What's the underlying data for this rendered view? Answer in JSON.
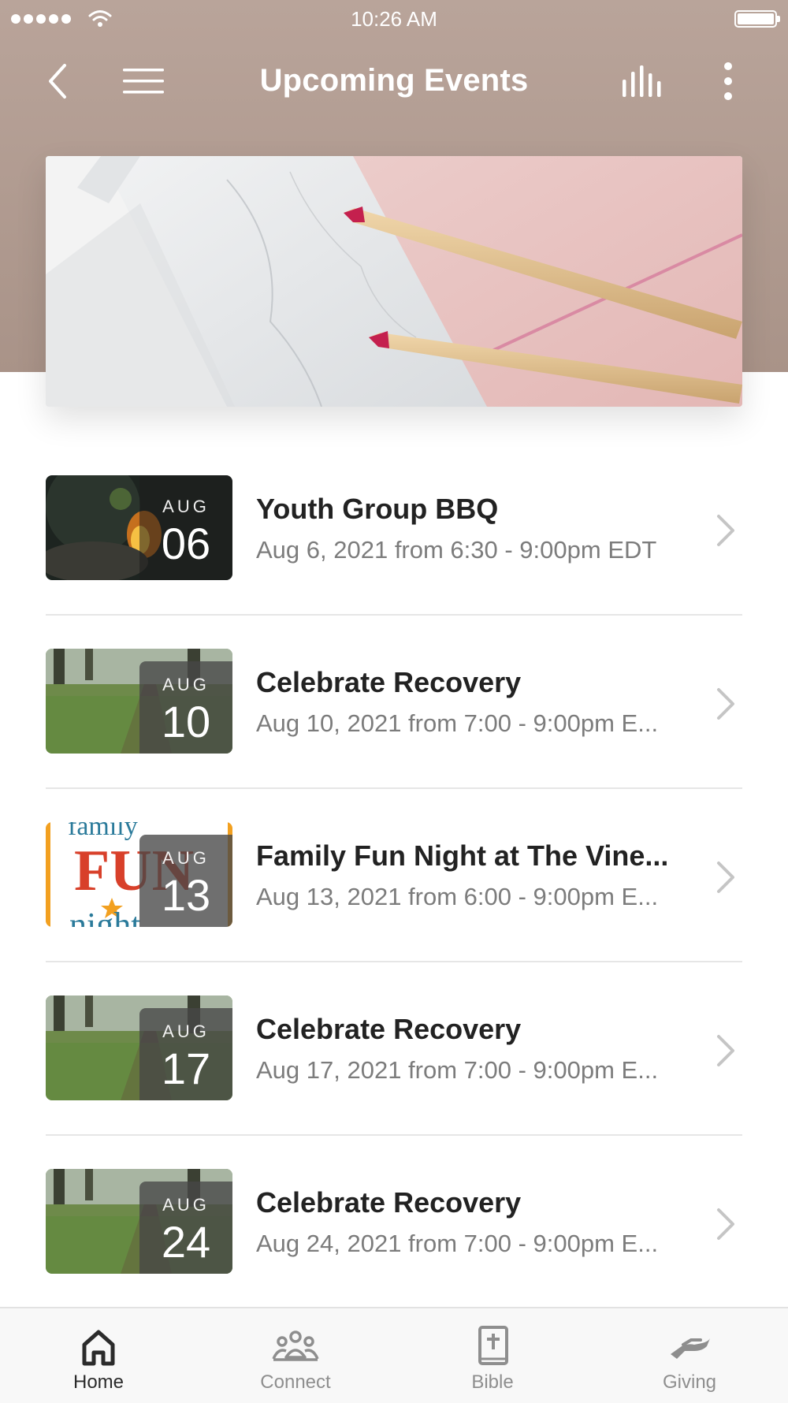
{
  "status_bar": {
    "time": "10:26 AM"
  },
  "nav": {
    "title": "Upcoming Events"
  },
  "events": [
    {
      "month": "AUG",
      "day": "06",
      "title": "Youth Group BBQ",
      "subtitle": "Aug 6, 2021 from 6:30 - 9:00pm EDT"
    },
    {
      "month": "AUG",
      "day": "10",
      "title": "Celebrate Recovery",
      "subtitle": "Aug 10, 2021 from 7:00 - 9:00pm E..."
    },
    {
      "month": "AUG",
      "day": "13",
      "title": "Family Fun Night at The Vine...",
      "subtitle": "Aug 13, 2021 from 6:00 - 9:00pm E..."
    },
    {
      "month": "AUG",
      "day": "17",
      "title": "Celebrate Recovery",
      "subtitle": "Aug 17, 2021 from 7:00 - 9:00pm E..."
    },
    {
      "month": "AUG",
      "day": "24",
      "title": "Celebrate Recovery",
      "subtitle": "Aug 24, 2021 from 7:00 - 9:00pm E..."
    }
  ],
  "thumbnail_text": {
    "family": "family",
    "fun": "FUN",
    "night": "night"
  },
  "tabs": [
    {
      "label": "Home",
      "icon": "home-icon",
      "active": true
    },
    {
      "label": "Connect",
      "icon": "people-icon",
      "active": false
    },
    {
      "label": "Bible",
      "icon": "bible-icon",
      "active": false
    },
    {
      "label": "Giving",
      "icon": "giving-hand-icon",
      "active": false
    }
  ],
  "colors": {
    "header": "#b9a49a",
    "active_tab": "#2b2b2b",
    "inactive_tab": "#8e8e8e"
  }
}
